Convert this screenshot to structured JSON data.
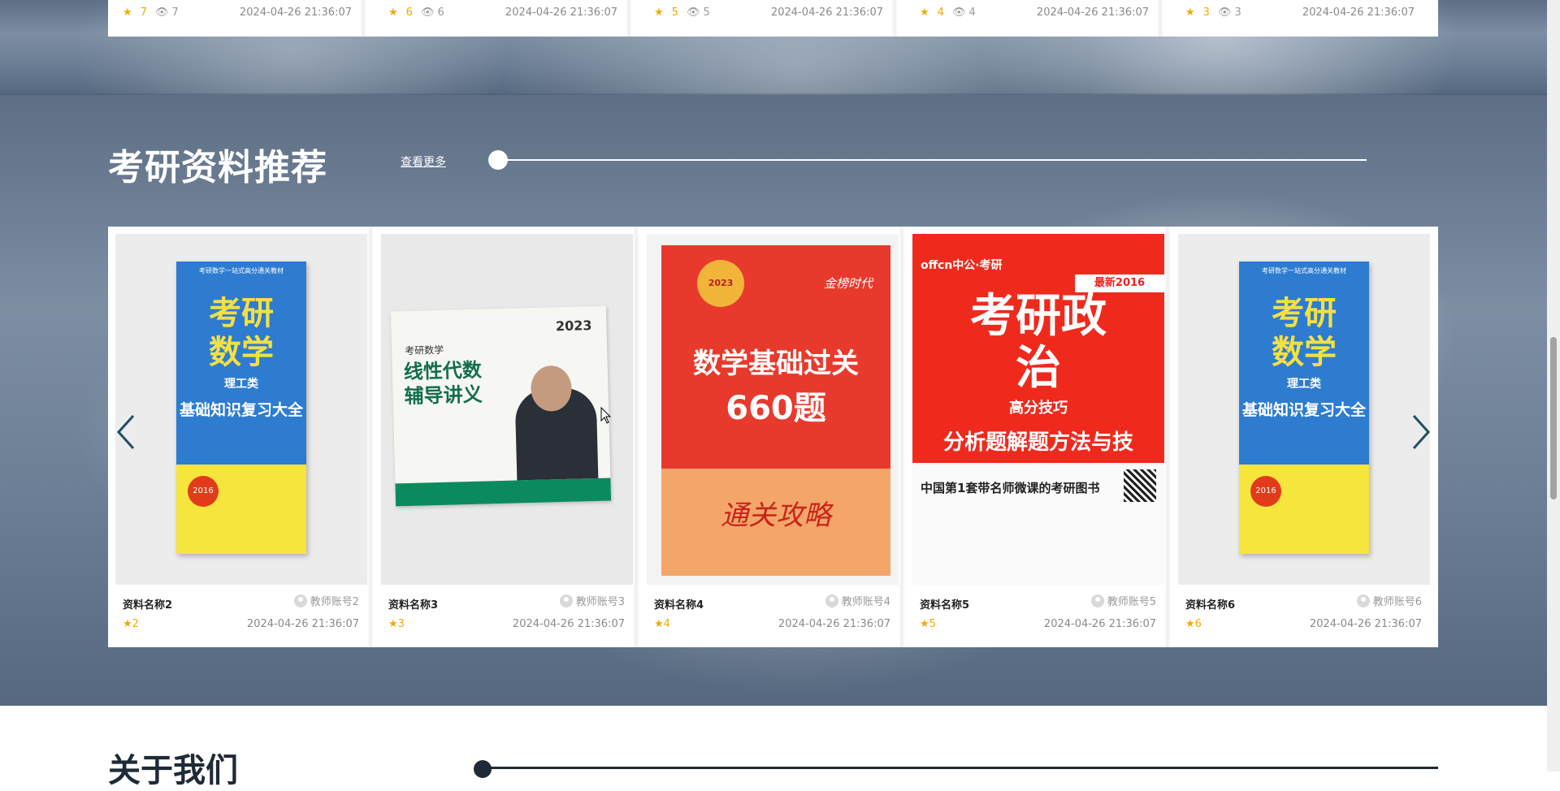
{
  "top_row": {
    "cards": [
      {
        "rating": "7",
        "views": "7",
        "date": "2024-04-26 21:36:07"
      },
      {
        "rating": "6",
        "views": "6",
        "date": "2024-04-26 21:36:07"
      },
      {
        "rating": "5",
        "views": "5",
        "date": "2024-04-26 21:36:07"
      },
      {
        "rating": "4",
        "views": "4",
        "date": "2024-04-26 21:36:07"
      },
      {
        "rating": "3",
        "views": "3",
        "date": "2024-04-26 21:36:07"
      }
    ]
  },
  "section": {
    "title": "考研资料推荐",
    "more_link": "查看更多"
  },
  "carousel": {
    "prev_icon": "chevron-left-icon",
    "next_icon": "chevron-right-icon",
    "items": [
      {
        "name": "资料名称2",
        "account": "教师账号2",
        "rating": "2",
        "date": "2024-04-26 21:36:07",
        "cover": {
          "top": "考研数学一站式高分通关教材",
          "title1": "考研",
          "title2": "数学",
          "sub": "理工类",
          "main": "基础知识复习大全",
          "badge": "2016"
        }
      },
      {
        "name": "资料名称3",
        "account": "教师账号3",
        "rating": "3",
        "date": "2024-04-26 21:36:07",
        "cover": {
          "year": "2023",
          "sub": "考研数学",
          "title1": "线性代数",
          "title2": "辅导讲义"
        }
      },
      {
        "name": "资料名称4",
        "account": "教师账号4",
        "rating": "4",
        "date": "2024-04-26 21:36:07",
        "cover": {
          "seal": "2023",
          "brand": "金榜时代",
          "title1": "数学基础过关",
          "title2": "660题",
          "lower": "通关攻略"
        }
      },
      {
        "name": "资料名称5",
        "account": "教师账号5",
        "rating": "5",
        "date": "2024-04-26 21:36:07",
        "cover": {
          "logo": "offcn中公·考研",
          "tag": "最新2016",
          "title": "考研政治",
          "sub": "高分技巧",
          "main": "分析题解题方法与技",
          "line": "中国第1套带名师微课的考研图书"
        }
      },
      {
        "name": "资料名称6",
        "account": "教师账号6",
        "rating": "6",
        "date": "2024-04-26 21:36:07",
        "cover": {
          "top": "考研数学一站式高分通关教材",
          "title1": "考研",
          "title2": "数学",
          "sub": "理工类",
          "main": "基础知识复习大全",
          "badge": "2016"
        }
      }
    ]
  },
  "next_section": {
    "title": "关于我们"
  },
  "colors": {
    "accent_star": "#f2a900",
    "arrow": "#1f4e62",
    "band": "#6a7c93"
  }
}
